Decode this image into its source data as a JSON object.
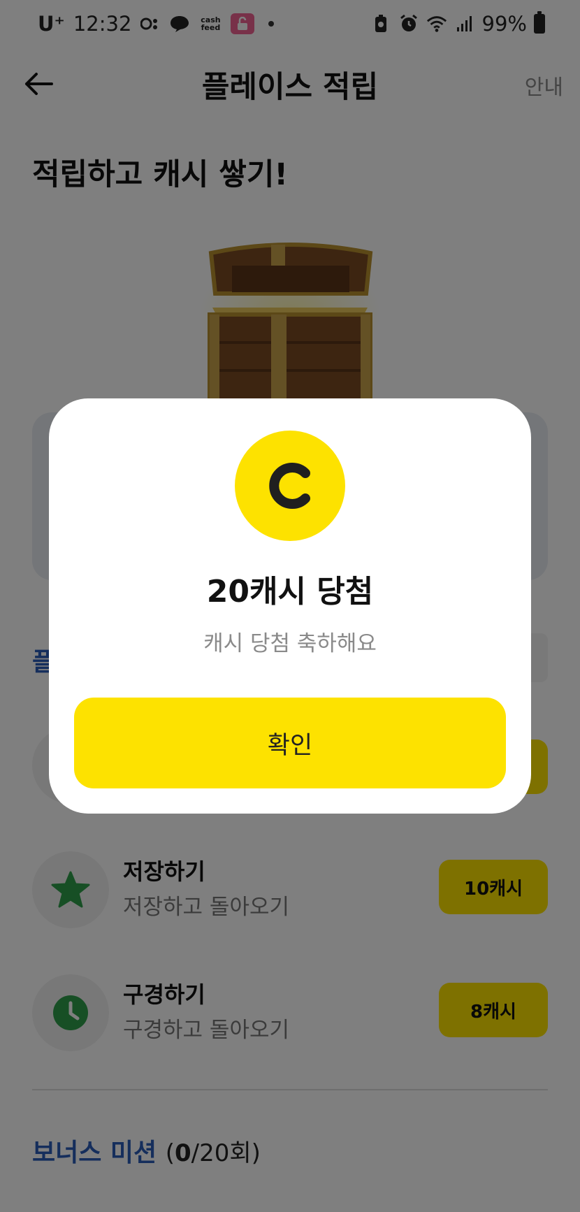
{
  "status_bar": {
    "carrier": "U⁺",
    "time": "12:32",
    "cashfeed_label": "cash feed",
    "battery": "99%"
  },
  "header": {
    "title": "플레이스 적립",
    "info_label": "안내"
  },
  "hero": {
    "title": "적립하고 캐시 쌓기!"
  },
  "section_peek": {
    "label": "플"
  },
  "missions": [
    {
      "title": "저장하기",
      "subtitle": "저장하고 돌아오기",
      "reward": "10캐시",
      "icon": "star-icon"
    },
    {
      "title": "구경하기",
      "subtitle": "구경하고 돌아오기",
      "reward": "8캐시",
      "icon": "clock-icon"
    }
  ],
  "bonus": {
    "title": "보너스 미션",
    "count_open": "(",
    "count_done": "0",
    "count_total": "/20회)"
  },
  "modal": {
    "coin_letter": "C",
    "title": "20캐시 당첨",
    "subtitle": "캐시 당첨 축하해요",
    "confirm_label": "확인"
  },
  "colors": {
    "accent_yellow": "#fde200",
    "brand_blue": "#2b5cb8",
    "icon_green": "#2e9e4a"
  }
}
